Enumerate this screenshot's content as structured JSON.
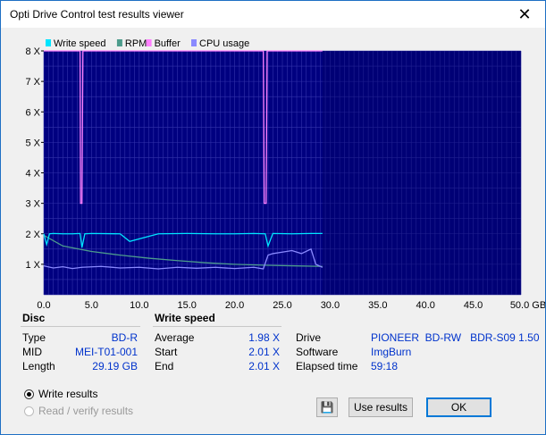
{
  "window": {
    "title": "Opti Drive Control test results viewer",
    "close_glyph": "✕"
  },
  "chart_data": {
    "type": "line",
    "legend": [
      "Write speed",
      "RPM",
      "Buffer",
      "CPU usage"
    ],
    "legend_placement": "top-left",
    "xlabel_unit": "GB",
    "x_ticks": [
      "0.0",
      "5.0",
      "10.0",
      "15.0",
      "20.0",
      "25.0",
      "30.0",
      "35.0",
      "40.0",
      "45.0",
      "50.0 GB"
    ],
    "y_ticks": [
      "1 X",
      "2 X",
      "3 X",
      "4 X",
      "5 X",
      "6 X",
      "7 X",
      "8 X"
    ],
    "xlim": [
      0,
      50
    ],
    "ylim": [
      0,
      8
    ],
    "grid": true,
    "colors": {
      "background": "#000080",
      "grid": "#3333aa",
      "write_speed": "#00e5ff",
      "rpm": "#4d9c8c",
      "buffer": "#ff80ff",
      "cpu": "#8a8aff"
    },
    "series": [
      {
        "name": "Write speed",
        "x": [
          0.0,
          0.3,
          0.6,
          1.0,
          2.0,
          3.0,
          3.8,
          4.0,
          4.3,
          5.0,
          8.0,
          9.0,
          12.0,
          15.0,
          18.0,
          20.0,
          22.0,
          23.2,
          23.5,
          24.0,
          26.0,
          28.0,
          29.2
        ],
        "y": [
          2.0,
          1.65,
          2.0,
          2.01,
          2.0,
          2.0,
          2.01,
          1.55,
          2.0,
          2.01,
          2.0,
          1.75,
          2.0,
          2.01,
          2.0,
          2.0,
          2.01,
          2.0,
          1.6,
          2.01,
          2.0,
          2.01,
          2.01
        ]
      },
      {
        "name": "RPM",
        "x": [
          0.0,
          2.0,
          5.0,
          8.0,
          11.0,
          14.0,
          17.0,
          20.0,
          23.0,
          26.0,
          29.2
        ],
        "y": [
          1.95,
          1.6,
          1.42,
          1.3,
          1.2,
          1.12,
          1.05,
          1.0,
          0.97,
          0.95,
          0.93
        ]
      },
      {
        "name": "Buffer",
        "x": [
          0.0,
          3.8,
          3.85,
          4.0,
          4.1,
          23.0,
          23.1,
          23.3,
          23.4,
          29.2
        ],
        "y": [
          8.0,
          8.0,
          3.0,
          3.0,
          8.0,
          8.0,
          3.0,
          3.0,
          8.0,
          8.0
        ]
      },
      {
        "name": "CPU usage",
        "x": [
          0.0,
          1.0,
          2.0,
          3.0,
          4.0,
          6.0,
          8.0,
          10.0,
          12.0,
          14.0,
          16.0,
          18.0,
          20.0,
          22.0,
          23.0,
          23.5,
          24.0,
          25.0,
          26.0,
          27.0,
          28.0,
          28.5,
          29.2
        ],
        "y": [
          0.95,
          0.88,
          0.92,
          0.86,
          0.9,
          0.93,
          0.88,
          0.9,
          0.85,
          0.9,
          0.87,
          0.9,
          0.86,
          0.9,
          0.85,
          1.3,
          1.35,
          1.4,
          1.45,
          1.35,
          1.5,
          1.0,
          0.9
        ]
      }
    ]
  },
  "disc": {
    "header": "Disc",
    "type_label": "Type",
    "type_value": "BD-R",
    "mid_label": "MID",
    "mid_value": "MEI-T01-001",
    "length_label": "Length",
    "length_value": "29.19 GB"
  },
  "write_speed": {
    "header": "Write speed",
    "average_label": "Average",
    "average_value": "1.98 X",
    "start_label": "Start",
    "start_value": "2.01 X",
    "end_label": "End",
    "end_value": "2.01 X"
  },
  "drive_info": {
    "drive_label": "Drive",
    "drive_value": "PIONEER  BD-RW   BDR-S09 1.50",
    "software_label": "Software",
    "software_value": "ImgBurn",
    "elapsed_label": "Elapsed time",
    "elapsed_value": "59:18"
  },
  "options": {
    "write_results": "Write results",
    "read_verify_results": "Read / verify results"
  },
  "buttons": {
    "save_icon": "💾",
    "use_results": "Use results",
    "ok": "OK"
  }
}
